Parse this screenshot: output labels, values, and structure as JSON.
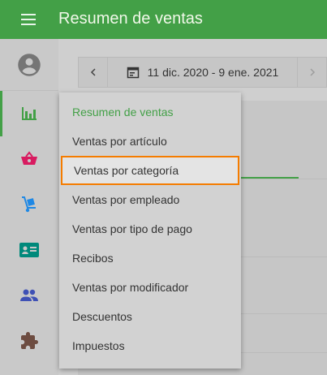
{
  "header": {
    "title": "Resumen de ventas",
    "menu_icon": "hamburger-menu-icon"
  },
  "sidebar": {
    "items": [
      {
        "name": "avatar",
        "icon": "account-circle-icon"
      },
      {
        "name": "reports",
        "icon": "bar-chart-icon",
        "active": true
      },
      {
        "name": "items",
        "icon": "basket-icon"
      },
      {
        "name": "inventory",
        "icon": "hand-truck-icon"
      },
      {
        "name": "employees",
        "icon": "id-card-icon"
      },
      {
        "name": "customers",
        "icon": "people-icon"
      },
      {
        "name": "integrations",
        "icon": "puzzle-icon"
      }
    ]
  },
  "datebar": {
    "prev_icon": "chevron-left-icon",
    "calendar_icon": "calendar-icon",
    "range": "11 dic. 2020 - 9 ene. 2021",
    "next_icon": "chevron-right-icon"
  },
  "menu": {
    "items": [
      {
        "label": "Resumen de ventas",
        "state": "current"
      },
      {
        "label": "Ventas por artículo"
      },
      {
        "label": "Ventas por categoría",
        "state": "highlighted"
      },
      {
        "label": "Ventas por empleado"
      },
      {
        "label": "Ventas por tipo de pago"
      },
      {
        "label": "Recibos"
      },
      {
        "label": "Ventas por modificador"
      },
      {
        "label": "Descuentos"
      },
      {
        "label": "Impuestos"
      }
    ]
  },
  "colors": {
    "brand": "#43a047",
    "highlight_border": "#f57c00",
    "basket": "#d81b60",
    "truck": "#1e88e5",
    "card": "#00897b",
    "people": "#3f51b5",
    "puzzle": "#6d4c41"
  }
}
